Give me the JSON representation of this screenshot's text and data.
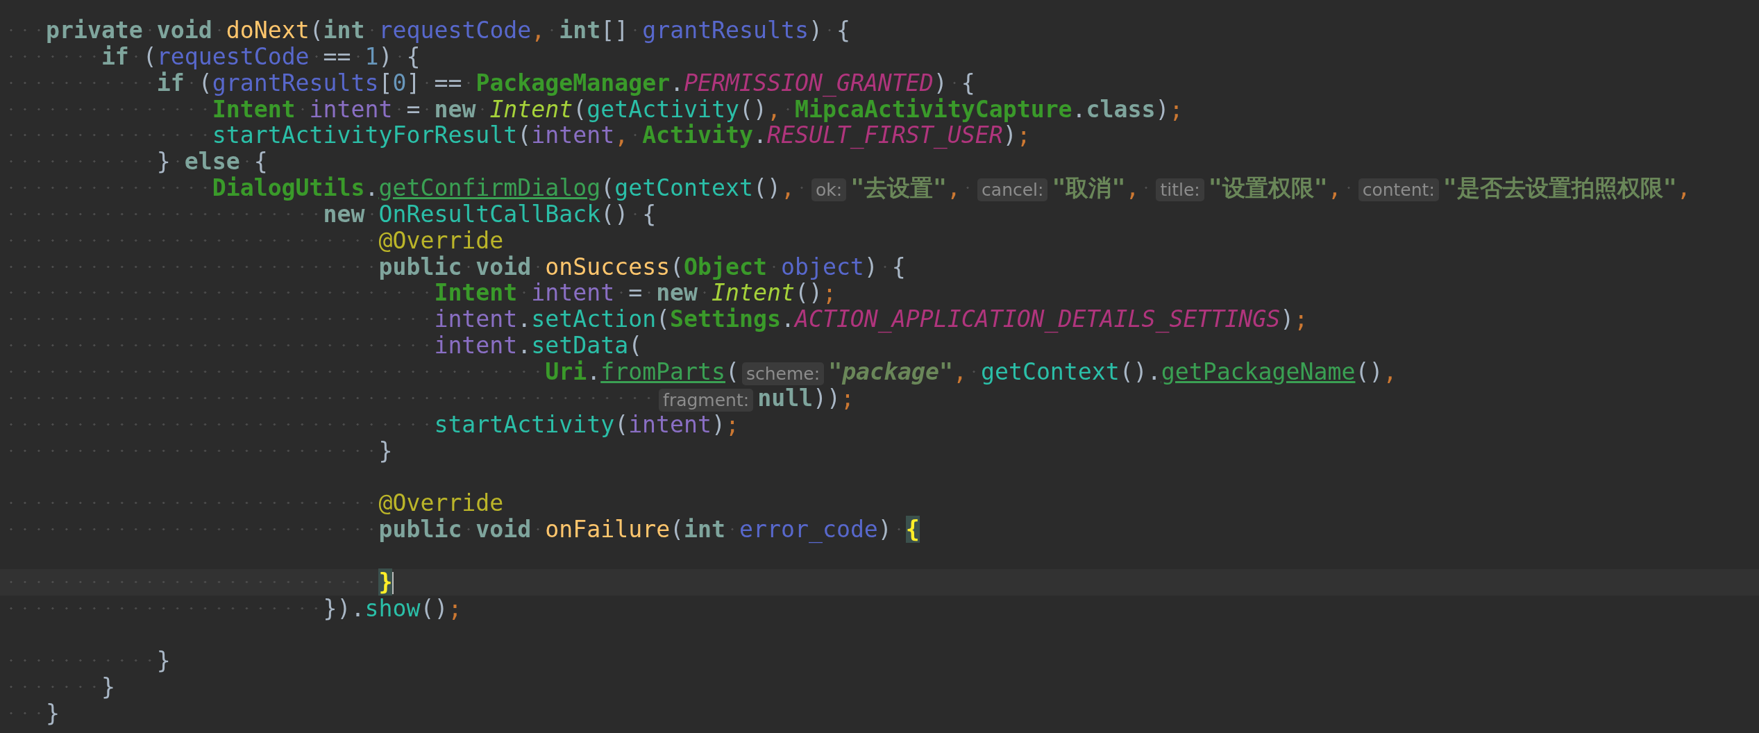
{
  "lines": [
    {
      "current": false,
      "tokens": [
        {
          "kind": "keyword",
          "text": "   private"
        },
        {
          "kind": "keyword",
          "text": " void"
        },
        {
          "kind": "declaration",
          "text": " doNext"
        },
        {
          "kind": "punct",
          "text": "("
        },
        {
          "kind": "keyword",
          "text": "int"
        },
        {
          "kind": "parameter",
          "text": " requestCode"
        },
        {
          "kind": "separator",
          "text": ","
        },
        {
          "kind": "keyword",
          "text": " int"
        },
        {
          "kind": "punct",
          "text": "[]"
        },
        {
          "kind": "parameter",
          "text": " grantResults"
        },
        {
          "kind": "punct",
          "text": ")"
        },
        {
          "kind": "punct",
          "text": " {"
        }
      ]
    },
    {
      "current": false,
      "tokens": [
        {
          "kind": "keyword",
          "text": "       if"
        },
        {
          "kind": "punct",
          "text": " ("
        },
        {
          "kind": "parameter",
          "text": "requestCode"
        },
        {
          "kind": "punct",
          "text": " =="
        },
        {
          "kind": "number",
          "text": " 1"
        },
        {
          "kind": "punct",
          "text": ")"
        },
        {
          "kind": "punct",
          "text": " {"
        }
      ]
    },
    {
      "current": false,
      "tokens": [
        {
          "kind": "keyword",
          "text": "           if"
        },
        {
          "kind": "punct",
          "text": " ("
        },
        {
          "kind": "parameter",
          "text": "grantResults"
        },
        {
          "kind": "punct",
          "text": "["
        },
        {
          "kind": "number",
          "text": "0"
        },
        {
          "kind": "punct",
          "text": "]"
        },
        {
          "kind": "punct",
          "text": " =="
        },
        {
          "kind": "class",
          "text": " PackageManager"
        },
        {
          "kind": "punct",
          "text": "."
        },
        {
          "kind": "constant",
          "text": "PERMISSION_GRANTED"
        },
        {
          "kind": "punct",
          "text": ")"
        },
        {
          "kind": "punct",
          "text": " {"
        }
      ]
    },
    {
      "current": false,
      "tokens": [
        {
          "kind": "class",
          "text": "               Intent"
        },
        {
          "kind": "local",
          "text": " intent"
        },
        {
          "kind": "punct",
          "text": " ="
        },
        {
          "kind": "keyword",
          "text": " new"
        },
        {
          "kind": "constructor",
          "text": " Intent"
        },
        {
          "kind": "punct",
          "text": "("
        },
        {
          "kind": "call",
          "text": "getActivity"
        },
        {
          "kind": "punct",
          "text": "()"
        },
        {
          "kind": "separator",
          "text": ","
        },
        {
          "kind": "class",
          "text": " MipcaActivityCapture"
        },
        {
          "kind": "punct",
          "text": "."
        },
        {
          "kind": "keyword",
          "text": "class"
        },
        {
          "kind": "punct",
          "text": ")"
        },
        {
          "kind": "separator",
          "text": ";"
        }
      ]
    },
    {
      "current": false,
      "tokens": [
        {
          "kind": "call",
          "text": "               startActivityForResult"
        },
        {
          "kind": "punct",
          "text": "("
        },
        {
          "kind": "local",
          "text": "intent"
        },
        {
          "kind": "separator",
          "text": ","
        },
        {
          "kind": "class",
          "text": " Activity"
        },
        {
          "kind": "punct",
          "text": "."
        },
        {
          "kind": "constant",
          "text": "RESULT_FIRST_USER"
        },
        {
          "kind": "punct",
          "text": ")"
        },
        {
          "kind": "separator",
          "text": ";"
        }
      ]
    },
    {
      "current": false,
      "tokens": [
        {
          "kind": "punct",
          "text": "           }"
        },
        {
          "kind": "keyword",
          "text": " else"
        },
        {
          "kind": "punct",
          "text": " {"
        }
      ]
    },
    {
      "current": false,
      "tokens": [
        {
          "kind": "class",
          "text": "               DialogUtils"
        },
        {
          "kind": "punct",
          "text": "."
        },
        {
          "kind": "static",
          "text": "getConfirmDialog"
        },
        {
          "kind": "punct",
          "text": "("
        },
        {
          "kind": "call",
          "text": "getContext"
        },
        {
          "kind": "punct",
          "text": "()"
        },
        {
          "kind": "separator",
          "text": ","
        },
        {
          "kind": "hint",
          "text": " ok:"
        },
        {
          "kind": "string",
          "text": "\"去设置\""
        },
        {
          "kind": "separator",
          "text": ","
        },
        {
          "kind": "hint",
          "text": " cancel:"
        },
        {
          "kind": "string",
          "text": "\"取消\""
        },
        {
          "kind": "separator",
          "text": ","
        },
        {
          "kind": "hint",
          "text": " title:"
        },
        {
          "kind": "string",
          "text": "\"设置权限\""
        },
        {
          "kind": "separator",
          "text": ","
        },
        {
          "kind": "hint",
          "text": " content:"
        },
        {
          "kind": "string",
          "text": "\"是否去设置拍照权限\""
        },
        {
          "kind": "separator",
          "text": ","
        }
      ]
    },
    {
      "current": false,
      "tokens": [
        {
          "kind": "keyword",
          "text": "                       new"
        },
        {
          "kind": "call",
          "text": " OnResultCallBack"
        },
        {
          "kind": "punct",
          "text": "()"
        },
        {
          "kind": "punct",
          "text": " {"
        }
      ]
    },
    {
      "current": false,
      "tokens": [
        {
          "kind": "annotation",
          "text": "                           @Override"
        }
      ]
    },
    {
      "current": false,
      "tokens": [
        {
          "kind": "keyword",
          "text": "                           public"
        },
        {
          "kind": "keyword",
          "text": " void"
        },
        {
          "kind": "declaration",
          "text": " onSuccess"
        },
        {
          "kind": "punct",
          "text": "("
        },
        {
          "kind": "class",
          "text": "Object"
        },
        {
          "kind": "parameter",
          "text": " object"
        },
        {
          "kind": "punct",
          "text": ")"
        },
        {
          "kind": "punct",
          "text": " {"
        }
      ]
    },
    {
      "current": false,
      "tokens": [
        {
          "kind": "class",
          "text": "                               Intent"
        },
        {
          "kind": "local",
          "text": " intent"
        },
        {
          "kind": "punct",
          "text": " ="
        },
        {
          "kind": "keyword",
          "text": " new"
        },
        {
          "kind": "constructor",
          "text": " Intent"
        },
        {
          "kind": "punct",
          "text": "()"
        },
        {
          "kind": "separator",
          "text": ";"
        }
      ]
    },
    {
      "current": false,
      "tokens": [
        {
          "kind": "local",
          "text": "                               intent"
        },
        {
          "kind": "punct",
          "text": "."
        },
        {
          "kind": "call",
          "text": "setAction"
        },
        {
          "kind": "punct",
          "text": "("
        },
        {
          "kind": "class",
          "text": "Settings"
        },
        {
          "kind": "punct",
          "text": "."
        },
        {
          "kind": "constant",
          "text": "ACTION_APPLICATION_DETAILS_SETTINGS"
        },
        {
          "kind": "punct",
          "text": ")"
        },
        {
          "kind": "separator",
          "text": ";"
        }
      ]
    },
    {
      "current": false,
      "tokens": [
        {
          "kind": "local",
          "text": "                               intent"
        },
        {
          "kind": "member_call",
          "text": ".setData"
        },
        {
          "kind": "punct",
          "text": "("
        }
      ]
    },
    {
      "current": false,
      "tokens": [
        {
          "kind": "class",
          "text": "                                       Uri"
        },
        {
          "kind": "punct",
          "text": "."
        },
        {
          "kind": "static",
          "text": "fromParts"
        },
        {
          "kind": "punct",
          "text": "("
        },
        {
          "kind": "hint",
          "text": "scheme:"
        },
        {
          "kind": "string_italic",
          "text": "\"package\""
        },
        {
          "kind": "separator",
          "text": ","
        },
        {
          "kind": "call",
          "text": " getContext"
        },
        {
          "kind": "punct",
          "text": "()."
        },
        {
          "kind": "static",
          "text": "getPackageName"
        },
        {
          "kind": "punct",
          "text": "()"
        },
        {
          "kind": "separator",
          "text": ","
        }
      ]
    },
    {
      "current": false,
      "tokens": [
        {
          "kind": "hint",
          "text": "                                               fragment:"
        },
        {
          "kind": "keyword",
          "text": "null"
        },
        {
          "kind": "punct",
          "text": "))"
        },
        {
          "kind": "separator",
          "text": ";"
        }
      ]
    },
    {
      "current": false,
      "tokens": [
        {
          "kind": "call",
          "text": "                               startActivity"
        },
        {
          "kind": "punct",
          "text": "("
        },
        {
          "kind": "local",
          "text": "intent"
        },
        {
          "kind": "punct",
          "text": ")"
        },
        {
          "kind": "separator",
          "text": ";"
        }
      ]
    },
    {
      "current": false,
      "tokens": [
        {
          "kind": "punct",
          "text": "                           }"
        }
      ]
    },
    {
      "current": false
    },
    {
      "current": false,
      "tokens": [
        {
          "kind": "annotation",
          "text": "                           @Override"
        }
      ]
    },
    {
      "current": false,
      "tokens": [
        {
          "kind": "keyword",
          "text": "                           public"
        },
        {
          "kind": "keyword",
          "text": " void"
        },
        {
          "kind": "declaration",
          "text": " onFailure"
        },
        {
          "kind": "punct",
          "text": "("
        },
        {
          "kind": "keyword",
          "text": "int"
        },
        {
          "kind": "parameter",
          "text": " error_code"
        },
        {
          "kind": "punct",
          "text": ")"
        },
        {
          "kind": "brace_match",
          "text": " {"
        }
      ]
    },
    {
      "current": false
    },
    {
      "current": true,
      "tokens": [
        {
          "kind": "brace_match",
          "text": "                           }"
        }
      ]
    },
    {
      "current": false,
      "tokens": [
        {
          "kind": "punct",
          "text": "                       })."
        },
        {
          "kind": "call",
          "text": "show"
        },
        {
          "kind": "punct",
          "text": "()"
        },
        {
          "kind": "separator",
          "text": ";"
        }
      ]
    },
    {
      "current": false
    },
    {
      "current": false,
      "tokens": [
        {
          "kind": "punct",
          "text": "           }"
        }
      ]
    },
    {
      "current": false,
      "tokens": [
        {
          "kind": "punct",
          "text": "       }"
        }
      ]
    },
    {
      "current": false,
      "tokens": [
        {
          "kind": "punct",
          "text": "   }"
        }
      ]
    }
  ]
}
